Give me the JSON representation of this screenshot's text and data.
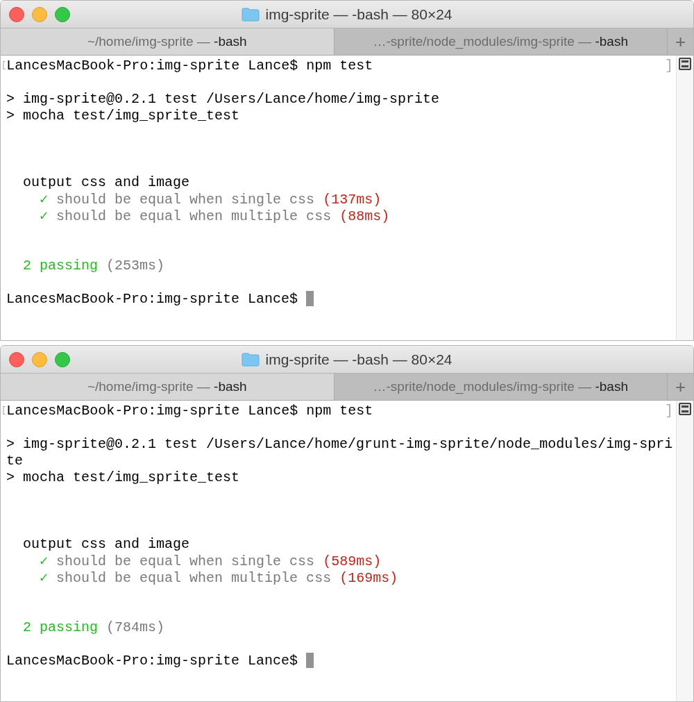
{
  "windows": [
    {
      "title": "img-sprite — -bash — 80×24",
      "tabs": [
        {
          "path": "~/home/img-sprite —",
          "process": "-bash",
          "selected": true
        },
        {
          "path": "…-sprite/node_modules/img-sprite —",
          "process": "-bash",
          "selected": false
        }
      ],
      "new_tab": "+",
      "lines": [
        {
          "kind": "text",
          "open_mark": "[",
          "close_mark": "]",
          "segments": [
            {
              "text": "LancesMacBook-Pro:img-sprite Lance$ npm test",
              "kind": "output"
            }
          ]
        },
        {
          "kind": "blank"
        },
        {
          "kind": "text",
          "segments": [
            {
              "text": "> img-sprite@0.2.1 test /Users/Lance/home/img-sprite",
              "kind": "output"
            }
          ]
        },
        {
          "kind": "text",
          "segments": [
            {
              "text": "> mocha test/img_sprite_test",
              "kind": "output"
            }
          ]
        },
        {
          "kind": "blank"
        },
        {
          "kind": "blank"
        },
        {
          "kind": "blank"
        },
        {
          "kind": "text",
          "segments": [
            {
              "text": "  output css and image",
              "kind": "output"
            }
          ]
        },
        {
          "kind": "text",
          "segments": [
            {
              "text": "    ✓",
              "kind": "check"
            },
            {
              "text": " should be equal when single css",
              "kind": "test"
            },
            {
              "text": " (137ms)",
              "kind": "duration"
            }
          ]
        },
        {
          "kind": "text",
          "segments": [
            {
              "text": "    ✓",
              "kind": "check"
            },
            {
              "text": " should be equal when multiple css",
              "kind": "test"
            },
            {
              "text": " (88ms)",
              "kind": "duration"
            }
          ]
        },
        {
          "kind": "blank"
        },
        {
          "kind": "blank"
        },
        {
          "kind": "text",
          "segments": [
            {
              "text": "  2 passing",
              "kind": "passing"
            },
            {
              "text": " (253ms)",
              "kind": "summary"
            }
          ]
        },
        {
          "kind": "blank"
        },
        {
          "kind": "text",
          "cursor": true,
          "segments": [
            {
              "text": "LancesMacBook-Pro:img-sprite Lance$ ",
              "kind": "output"
            }
          ]
        }
      ]
    },
    {
      "title": "img-sprite — -bash — 80×24",
      "tabs": [
        {
          "path": "~/home/img-sprite —",
          "process": "-bash",
          "selected": true
        },
        {
          "path": "…-sprite/node_modules/img-sprite —",
          "process": "-bash",
          "selected": false
        }
      ],
      "new_tab": "+",
      "lines": [
        {
          "kind": "text",
          "open_mark": "[",
          "close_mark": "]",
          "segments": [
            {
              "text": "LancesMacBook-Pro:img-sprite Lance$ npm test",
              "kind": "output"
            }
          ]
        },
        {
          "kind": "blank"
        },
        {
          "kind": "text",
          "segments": [
            {
              "text": "> img-sprite@0.2.1 test /Users/Lance/home/grunt-img-sprite/node_modules/img-spri",
              "kind": "output"
            }
          ]
        },
        {
          "kind": "text",
          "segments": [
            {
              "text": "te",
              "kind": "output"
            }
          ]
        },
        {
          "kind": "text",
          "segments": [
            {
              "text": "> mocha test/img_sprite_test",
              "kind": "output"
            }
          ]
        },
        {
          "kind": "blank"
        },
        {
          "kind": "blank"
        },
        {
          "kind": "blank"
        },
        {
          "kind": "text",
          "segments": [
            {
              "text": "  output css and image",
              "kind": "output"
            }
          ]
        },
        {
          "kind": "text",
          "segments": [
            {
              "text": "    ✓",
              "kind": "check"
            },
            {
              "text": " should be equal when single css",
              "kind": "test"
            },
            {
              "text": " (589ms)",
              "kind": "duration"
            }
          ]
        },
        {
          "kind": "text",
          "segments": [
            {
              "text": "    ✓",
              "kind": "check"
            },
            {
              "text": " should be equal when multiple css",
              "kind": "test"
            },
            {
              "text": " (169ms)",
              "kind": "duration"
            }
          ]
        },
        {
          "kind": "blank"
        },
        {
          "kind": "blank"
        },
        {
          "kind": "text",
          "segments": [
            {
              "text": "  2 passing",
              "kind": "passing"
            },
            {
              "text": " (784ms)",
              "kind": "summary"
            }
          ]
        },
        {
          "kind": "blank"
        },
        {
          "kind": "text",
          "cursor": true,
          "segments": [
            {
              "text": "LancesMacBook-Pro:img-sprite Lance$ ",
              "kind": "output"
            }
          ]
        }
      ]
    }
  ]
}
